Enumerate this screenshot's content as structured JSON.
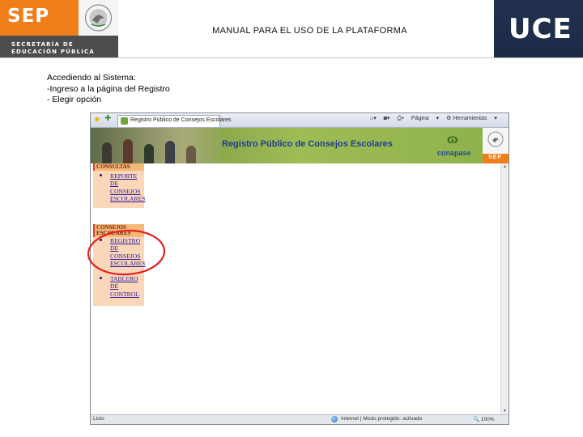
{
  "header": {
    "logo_text": "SEP",
    "logo_sub_line1": "SECRETARÍA DE",
    "logo_sub_line2": "EDUCACIÓN PÚBLICA",
    "title": "MANUAL PARA EL USO DE LA PLATAFORMA",
    "right_logo": "UCE"
  },
  "intro": {
    "line1": "Accediendo al Sistema:",
    "line2": "-Ingreso a la página del Registro",
    "line3": "- Elegir opción"
  },
  "browser": {
    "tab_label": "Registro Público de Consejos Escolares",
    "tools": {
      "pagina": "Página",
      "herramientas": "Herramientas"
    },
    "banner_title": "Registro Público de Consejos Escolares",
    "conapase_label": "conapase",
    "sep_mini": "SEP",
    "status_left": "Listo",
    "status_mid": "Internet | Modo protegido: activado",
    "status_zoom": "100%"
  },
  "menu": {
    "consultas": {
      "header": "CONSULTAS",
      "items": [
        {
          "lines": [
            "REPORTE",
            "DE",
            "CONSEJOS",
            "ESCOLARES"
          ]
        }
      ]
    },
    "consejos": {
      "header_line1": "CONSEJOS",
      "header_line2": "ESCOLARES",
      "items": [
        {
          "lines": [
            "REGISTRO",
            "DE",
            "CONSEJOS",
            "ESCOLARES"
          ]
        },
        {
          "lines": [
            "TABLERO",
            "DE",
            "CONTROL"
          ]
        }
      ]
    }
  },
  "colors": {
    "sep_orange": "#f07e1a",
    "uce_navy": "#1b2a46",
    "highlight_circle": "#e41e1e",
    "menu_bg": "#fad7b9",
    "link": "#2a1a9a"
  }
}
